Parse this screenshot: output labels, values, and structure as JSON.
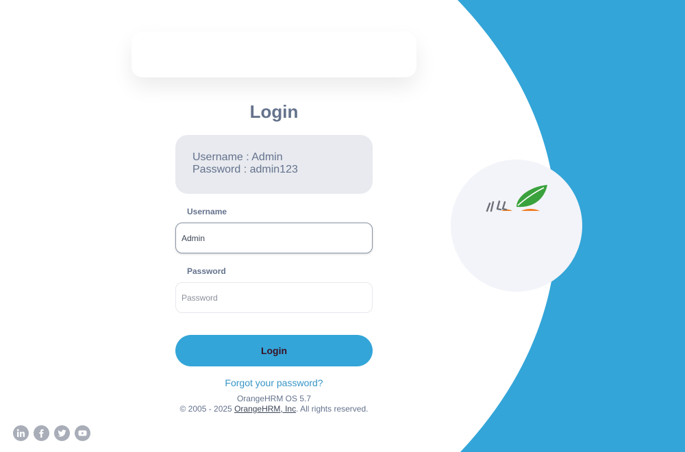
{
  "login": {
    "title": "Login",
    "credentials_username": "Username : Admin",
    "credentials_password": "Password : admin123",
    "username_label": "Username",
    "username_value": "Admin",
    "password_label": "Password",
    "password_placeholder": "Password",
    "login_button": "Login",
    "forgot_link": "Forgot your password?"
  },
  "footer": {
    "version": "OrangeHRM OS 5.7",
    "copyright_prefix": "© 2005 - 2025 ",
    "company_link": "OrangeHRM, Inc",
    "copyright_suffix": ". All rights reserved."
  },
  "socials": [
    {
      "icon": "linkedin-icon"
    },
    {
      "icon": "facebook-icon"
    },
    {
      "icon": "twitter-icon"
    },
    {
      "icon": "youtube-icon"
    }
  ],
  "colors": {
    "accent_blue": "#33a5d8",
    "text_slate": "#64728c",
    "cred_box_bg": "#e8eaef",
    "leaf_green": "#3aa23d",
    "orange": "#f07c22"
  }
}
